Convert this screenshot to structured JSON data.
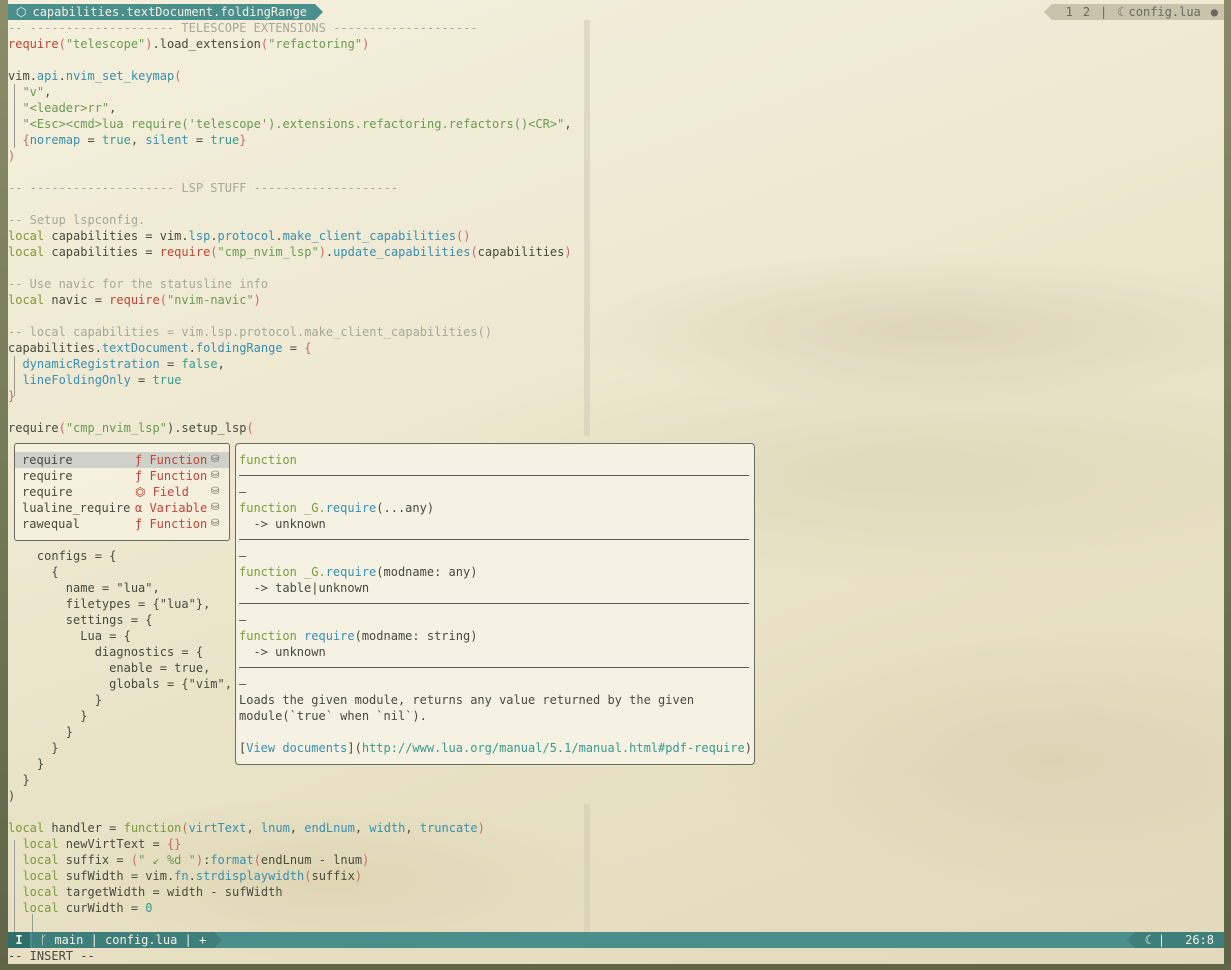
{
  "winbar": {
    "icon": "cube-icon",
    "breadcrumb": "capabilities.textDocument.foldingRange",
    "tab1": "1",
    "tab2": "2",
    "sep": "|",
    "file_icon": "lua-icon",
    "filename": "config.lua",
    "modified_dot": "●"
  },
  "code_top": [
    {
      "segs": [
        [
          "c",
          "-- -------------------- TELESCOPE EXTENSIONS --------------------"
        ]
      ]
    },
    {
      "segs": [
        [
          "r",
          "require"
        ],
        [
          "p",
          "("
        ],
        [
          "s",
          "\"telescope\""
        ],
        [
          "p",
          ")"
        ],
        [
          "t",
          ".load_extension"
        ],
        [
          "p",
          "("
        ],
        [
          "s",
          "\"refactoring\""
        ],
        [
          "p",
          ")"
        ]
      ]
    },
    {
      "segs": []
    },
    {
      "segs": [
        [
          "t",
          "vim"
        ],
        [
          "t",
          "."
        ],
        [
          "f",
          "api"
        ],
        [
          "t",
          "."
        ],
        [
          "f",
          "nvim_set_keymap"
        ],
        [
          "p",
          "("
        ]
      ]
    },
    {
      "segs": [
        [
          "t",
          "  "
        ],
        [
          "s",
          "\"v\""
        ],
        [
          "t",
          ","
        ]
      ]
    },
    {
      "segs": [
        [
          "t",
          "  "
        ],
        [
          "s",
          "\"<leader>rr\""
        ],
        [
          "t",
          ","
        ]
      ]
    },
    {
      "segs": [
        [
          "t",
          "  "
        ],
        [
          "s",
          "\"<Esc><cmd>lua require('telescope').extensions.refactoring.refactors()<CR>\""
        ],
        [
          "t",
          ","
        ]
      ]
    },
    {
      "segs": [
        [
          "t",
          "  "
        ],
        [
          "p",
          "{"
        ],
        [
          "f",
          "noremap"
        ],
        [
          "t",
          " = "
        ],
        [
          "b",
          "true"
        ],
        [
          "t",
          ", "
        ],
        [
          "f",
          "silent"
        ],
        [
          "t",
          " = "
        ],
        [
          "b",
          "true"
        ],
        [
          "p",
          "}"
        ]
      ]
    },
    {
      "segs": [
        [
          "p",
          ")"
        ]
      ]
    },
    {
      "segs": []
    },
    {
      "segs": [
        [
          "c",
          "-- -------------------- LSP STUFF --------------------"
        ]
      ]
    },
    {
      "segs": []
    },
    {
      "segs": [
        [
          "c",
          "-- Setup lspconfig."
        ]
      ]
    },
    {
      "segs": [
        [
          "k",
          "local"
        ],
        [
          "t",
          " capabilities = vim."
        ],
        [
          "f",
          "lsp"
        ],
        [
          "t",
          "."
        ],
        [
          "f",
          "protocol"
        ],
        [
          "t",
          "."
        ],
        [
          "f",
          "make_client_capabilities"
        ],
        [
          "p",
          "()"
        ]
      ]
    },
    {
      "segs": [
        [
          "k",
          "local"
        ],
        [
          "t",
          " capabilities = "
        ],
        [
          "r",
          "require"
        ],
        [
          "p",
          "("
        ],
        [
          "s",
          "\"cmp_nvim_lsp\""
        ],
        [
          "p",
          ")"
        ],
        [
          "t",
          "."
        ],
        [
          "f",
          "update_capabilities"
        ],
        [
          "p",
          "("
        ],
        [
          "t",
          "capabilities"
        ],
        [
          "p",
          ")"
        ]
      ]
    },
    {
      "segs": []
    },
    {
      "segs": [
        [
          "c",
          "-- Use navic for the statusline info"
        ]
      ]
    },
    {
      "segs": [
        [
          "k",
          "local"
        ],
        [
          "t",
          " navic = "
        ],
        [
          "r",
          "require"
        ],
        [
          "p",
          "("
        ],
        [
          "s",
          "\"nvim-navic\""
        ],
        [
          "p",
          ")"
        ]
      ]
    },
    {
      "segs": []
    },
    {
      "segs": [
        [
          "c",
          "-- local capabilities = vim.lsp.protocol.make_client_capabilities()"
        ]
      ]
    },
    {
      "segs": [
        [
          "t",
          "capabilities."
        ],
        [
          "f",
          "textDocument"
        ],
        [
          "t",
          "."
        ],
        [
          "f",
          "foldingRange"
        ],
        [
          "t",
          " = "
        ],
        [
          "p",
          "{"
        ]
      ]
    },
    {
      "segs": [
        [
          "t",
          "  "
        ],
        [
          "f",
          "dynamicRegistration"
        ],
        [
          "t",
          " = "
        ],
        [
          "b",
          "false"
        ],
        [
          "t",
          ","
        ]
      ]
    },
    {
      "segs": [
        [
          "t",
          "  "
        ],
        [
          "f",
          "lineFoldingOnly"
        ],
        [
          "t",
          " = "
        ],
        [
          "b",
          "true"
        ]
      ]
    },
    {
      "segs": [
        [
          "p",
          "}"
        ]
      ]
    },
    {
      "segs": []
    },
    {
      "segs": [
        [
          "t",
          "require"
        ],
        [
          "p",
          "("
        ],
        [
          "s",
          "\"cmp_nvim_lsp\""
        ],
        [
          "t",
          ")."
        ],
        [
          "t",
          "setup_lsp"
        ],
        [
          "p",
          "("
        ]
      ]
    }
  ],
  "code_mid": [
    {
      "segs": [
        [
          "t",
          "    configs = {"
        ]
      ]
    },
    {
      "segs": [
        [
          "t",
          "      {"
        ]
      ]
    },
    {
      "segs": [
        [
          "t",
          "        name = \"lua\","
        ]
      ]
    },
    {
      "segs": [
        [
          "t",
          "        filetypes = {\"lua\"},"
        ]
      ]
    },
    {
      "segs": [
        [
          "t",
          "        settings = {"
        ]
      ]
    },
    {
      "segs": [
        [
          "t",
          "          Lua = {"
        ]
      ]
    },
    {
      "segs": [
        [
          "t",
          "            diagnostics = {"
        ]
      ]
    },
    {
      "segs": [
        [
          "t",
          "              enable = true,"
        ]
      ]
    },
    {
      "segs": [
        [
          "t",
          "              globals = {\"vim\","
        ]
      ]
    },
    {
      "segs": [
        [
          "t",
          "            }"
        ]
      ]
    },
    {
      "segs": [
        [
          "t",
          "          }"
        ]
      ]
    },
    {
      "segs": [
        [
          "t",
          "        }"
        ]
      ]
    },
    {
      "segs": [
        [
          "t",
          "      }"
        ]
      ]
    },
    {
      "segs": [
        [
          "t",
          "    }"
        ]
      ]
    },
    {
      "segs": [
        [
          "t",
          "  }"
        ]
      ]
    },
    {
      "segs": [
        [
          "t",
          ")"
        ]
      ]
    },
    {
      "segs": []
    },
    {
      "segs": [
        [
          "k",
          "local"
        ],
        [
          "t",
          " handler = "
        ],
        [
          "k",
          "function"
        ],
        [
          "p",
          "("
        ],
        [
          "f",
          "virtText"
        ],
        [
          "t",
          ", "
        ],
        [
          "f",
          "lnum"
        ],
        [
          "t",
          ", "
        ],
        [
          "f",
          "endLnum"
        ],
        [
          "t",
          ", "
        ],
        [
          "f",
          "width"
        ],
        [
          "t",
          ", "
        ],
        [
          "f",
          "truncate"
        ],
        [
          "p",
          ")"
        ]
      ]
    },
    {
      "segs": [
        [
          "t",
          "  "
        ],
        [
          "k",
          "local"
        ],
        [
          "t",
          " newVirtText = "
        ],
        [
          "p",
          "{}"
        ]
      ]
    },
    {
      "segs": [
        [
          "t",
          "  "
        ],
        [
          "k",
          "local"
        ],
        [
          "t",
          " suffix = "
        ],
        [
          "p",
          "("
        ],
        [
          "s",
          "\" ↙ %d \""
        ],
        [
          "p",
          ")"
        ],
        [
          "t",
          ":"
        ],
        [
          "f",
          "format"
        ],
        [
          "p",
          "("
        ],
        [
          "t",
          "endLnum - lnum"
        ],
        [
          "p",
          ")"
        ]
      ]
    },
    {
      "segs": [
        [
          "t",
          "  "
        ],
        [
          "k",
          "local"
        ],
        [
          "t",
          " sufWidth = vim."
        ],
        [
          "f",
          "fn"
        ],
        [
          "t",
          "."
        ],
        [
          "f",
          "strdisplaywidth"
        ],
        [
          "p",
          "("
        ],
        [
          "t",
          "suffix"
        ],
        [
          "p",
          ")"
        ]
      ]
    },
    {
      "segs": [
        [
          "t",
          "  "
        ],
        [
          "k",
          "local"
        ],
        [
          "t",
          " targetWidth = width - sufWidth"
        ]
      ]
    },
    {
      "segs": [
        [
          "t",
          "  "
        ],
        [
          "k",
          "local"
        ],
        [
          "t",
          " curWidth = "
        ],
        [
          "b",
          "0"
        ]
      ]
    }
  ],
  "completion": {
    "items": [
      {
        "word": "require",
        "kind_icon": "ƒ",
        "kind": "Function",
        "src": "⛁"
      },
      {
        "word": "require",
        "kind_icon": "ƒ",
        "kind": "Function",
        "src": "⛁"
      },
      {
        "word": "require",
        "kind_icon": "⏣",
        "kind": "Field",
        "src": "⛁"
      },
      {
        "word": "lualine_require",
        "kind_icon": "α",
        "kind": "Variable",
        "src": "⛁"
      },
      {
        "word": "rawequal",
        "kind_icon": "ƒ",
        "kind": "Function",
        "src": "⛁"
      }
    ]
  },
  "docs": {
    "l1": "function",
    "dash": "—",
    "sig1a": "function _G.",
    "sig1b": "require",
    "sig1c": "(...any)",
    "ret1": "  -> unknown",
    "sig2a": "function _G.",
    "sig2b": "require",
    "sig2c": "(modname: any)",
    "ret2": "  -> table|unknown",
    "sig3a": "function ",
    "sig3b": "require",
    "sig3c": "(modname: string)",
    "ret3": "  -> unknown",
    "desc1": "Loads the given module, returns any value returned by the given",
    "desc2": "module(`true` when `nil`).",
    "link_a": "[",
    "link_b": "View documents",
    "link_c": "](",
    "link_url": "http://www.lua.org/manual/5.1/manual.html#pdf-require",
    "link_d": ")"
  },
  "status": {
    "mode": "I",
    "branch_icon": "git-branch-icon",
    "branch_glyph": "ᚴ",
    "branch": "main",
    "sep1": "|",
    "file": "config.lua",
    "sep2": "|",
    "plus": "+",
    "lang_icon": "lua-icon",
    "sep3": "|",
    "position": "26:8"
  },
  "cmdline": "-- INSERT --"
}
